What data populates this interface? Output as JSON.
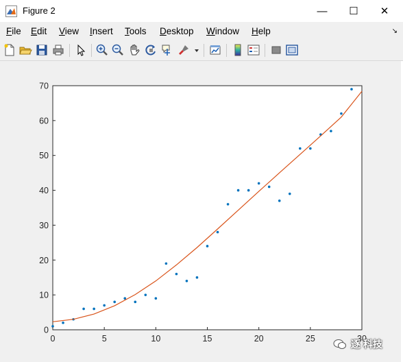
{
  "window": {
    "title": "Figure 2",
    "minimize": "—",
    "maximize": "☐",
    "close": "✕"
  },
  "menu": {
    "items": [
      {
        "u": "F",
        "rest": "ile"
      },
      {
        "u": "E",
        "rest": "dit"
      },
      {
        "u": "V",
        "rest": "iew"
      },
      {
        "u": "I",
        "rest": "nsert"
      },
      {
        "u": "T",
        "rest": "ools"
      },
      {
        "u": "D",
        "rest": "esktop"
      },
      {
        "u": "W",
        "rest": "indow"
      },
      {
        "u": "H",
        "rest": "elp"
      }
    ],
    "dock_arrow": "↘"
  },
  "toolbar": {
    "buttons": [
      "new-figure-icon",
      "open-icon",
      "save-icon",
      "print-icon",
      "pointer-icon",
      "zoom-in-icon",
      "zoom-out-icon",
      "pan-icon",
      "rotate-3d-icon",
      "data-cursor-icon",
      "brush-icon",
      "brush-dropdown-icon",
      "link-plot-icon",
      "colorbar-icon",
      "legend-icon",
      "hide-plot-tools-icon",
      "show-plot-tools-icon"
    ]
  },
  "chart_data": {
    "type": "scatter",
    "xlim": [
      0,
      30
    ],
    "ylim": [
      0,
      70
    ],
    "xticks": [
      0,
      5,
      10,
      15,
      20,
      25,
      30
    ],
    "yticks": [
      0,
      10,
      20,
      30,
      40,
      50,
      60,
      70
    ],
    "grid": false,
    "series": [
      {
        "kind": "scatter",
        "color": "#0072bd",
        "x": [
          0,
          1,
          2,
          3,
          4,
          5,
          6,
          7,
          8,
          9,
          10,
          11,
          12,
          13,
          14,
          15,
          16,
          17,
          18,
          19,
          20,
          21,
          22,
          23,
          24,
          25,
          26,
          27,
          28,
          29
        ],
        "y": [
          1,
          2,
          3,
          6,
          6,
          7,
          8,
          9,
          8,
          10,
          9,
          19,
          16,
          14,
          15,
          24,
          28,
          36,
          40,
          40,
          42,
          41,
          37,
          39,
          52,
          52,
          56,
          57,
          62,
          69
        ]
      },
      {
        "kind": "line",
        "color": "#d95319",
        "x": [
          0,
          2,
          4,
          6,
          8,
          10,
          12,
          14,
          16,
          18,
          20,
          22,
          24,
          26,
          28,
          30
        ],
        "y": [
          2.3,
          3.0,
          4.5,
          6.9,
          10.1,
          14.0,
          18.6,
          23.6,
          28.9,
          34.3,
          39.7,
          45.0,
          50.3,
          55.6,
          61.0,
          68.4
        ]
      }
    ]
  },
  "watermark": {
    "text": "逐 科技"
  }
}
